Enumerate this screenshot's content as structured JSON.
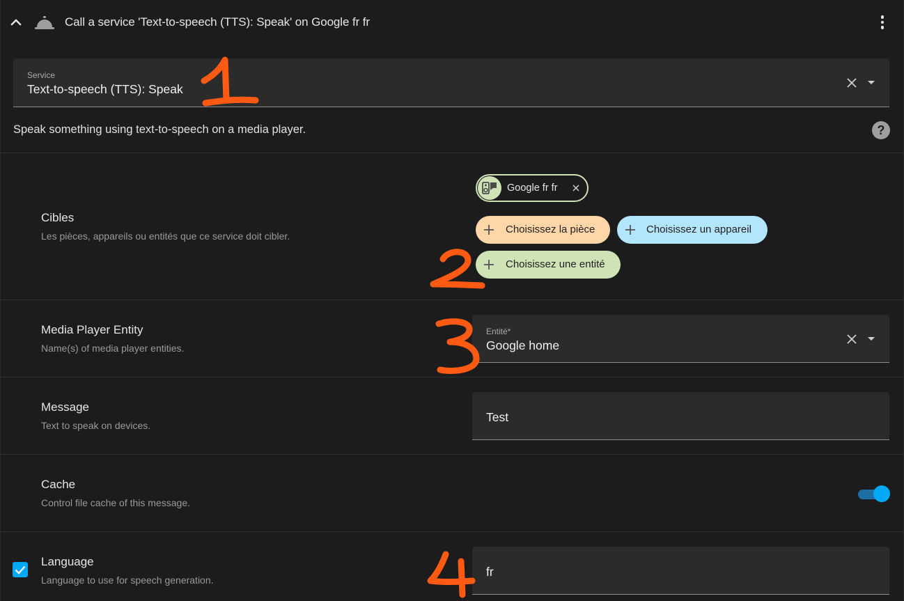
{
  "header": {
    "title": "Call a service 'Text-to-speech (TTS): Speak' on Google fr fr"
  },
  "service_field": {
    "label": "Service",
    "value": "Text-to-speech (TTS): Speak"
  },
  "service_description": "Speak something using text-to-speech on a media player.",
  "targets": {
    "title": "Cibles",
    "description": "Les pièces, appareils ou entités que ce service doit cibler.",
    "selected_chip": "Google fr fr",
    "choose_area": "Choisissez la pièce",
    "choose_device": "Choisissez un appareil",
    "choose_entity": "Choisissez une entité"
  },
  "media_player": {
    "title": "Media Player Entity",
    "description": "Name(s) of media player entities.",
    "field_label": "Entité*",
    "field_value": "Google home"
  },
  "message": {
    "title": "Message",
    "description": "Text to speak on devices.",
    "value": "Test"
  },
  "cache": {
    "title": "Cache",
    "description": "Control file cache of this message.",
    "enabled": true
  },
  "language": {
    "title": "Language",
    "description": "Language to use for speech generation.",
    "value": "fr",
    "checked": true
  },
  "colors": {
    "accent": "#03a9f4",
    "area_chip": "#ffd6a8",
    "device_chip": "#b3e5fc",
    "entity_chip": "#cfe3b7",
    "annotation": "#ff5a14"
  },
  "icons": [
    "chevron-up-icon",
    "service-bell-icon",
    "more-vert-icon",
    "close-icon",
    "dropdown-arrow-icon",
    "help-icon",
    "plus-icon",
    "speaker-icon",
    "check-icon"
  ]
}
